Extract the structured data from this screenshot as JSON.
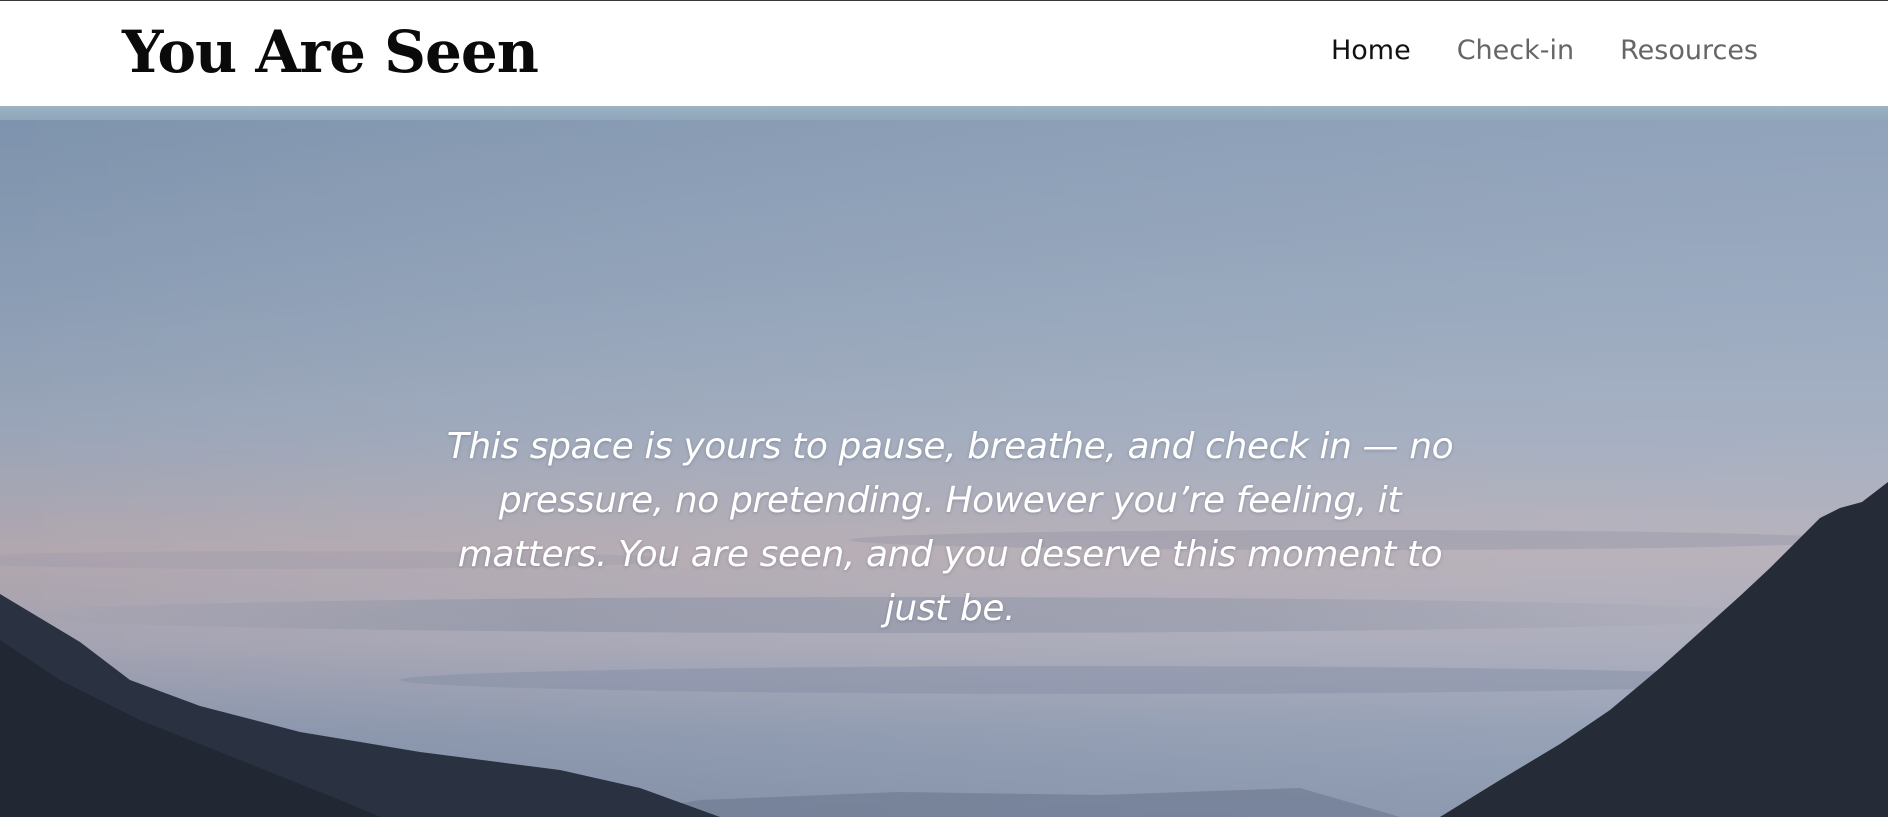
{
  "header": {
    "site_title": "You Are Seen",
    "nav": [
      {
        "label": "Home",
        "active": true
      },
      {
        "label": "Check-in",
        "active": false
      },
      {
        "label": "Resources",
        "active": false
      }
    ]
  },
  "hero": {
    "message": "This space is yours to pause, breathe, and check in — no pressure, no pretending. However you’re feeling, it matters. You are seen, and you deserve this moment to just be."
  },
  "colors": {
    "nav_active": "#111111",
    "nav_inactive": "#666666",
    "sky_top": "#7f93ad",
    "sky_horizon": "#b3a6ad",
    "mountains": "#232a36"
  }
}
